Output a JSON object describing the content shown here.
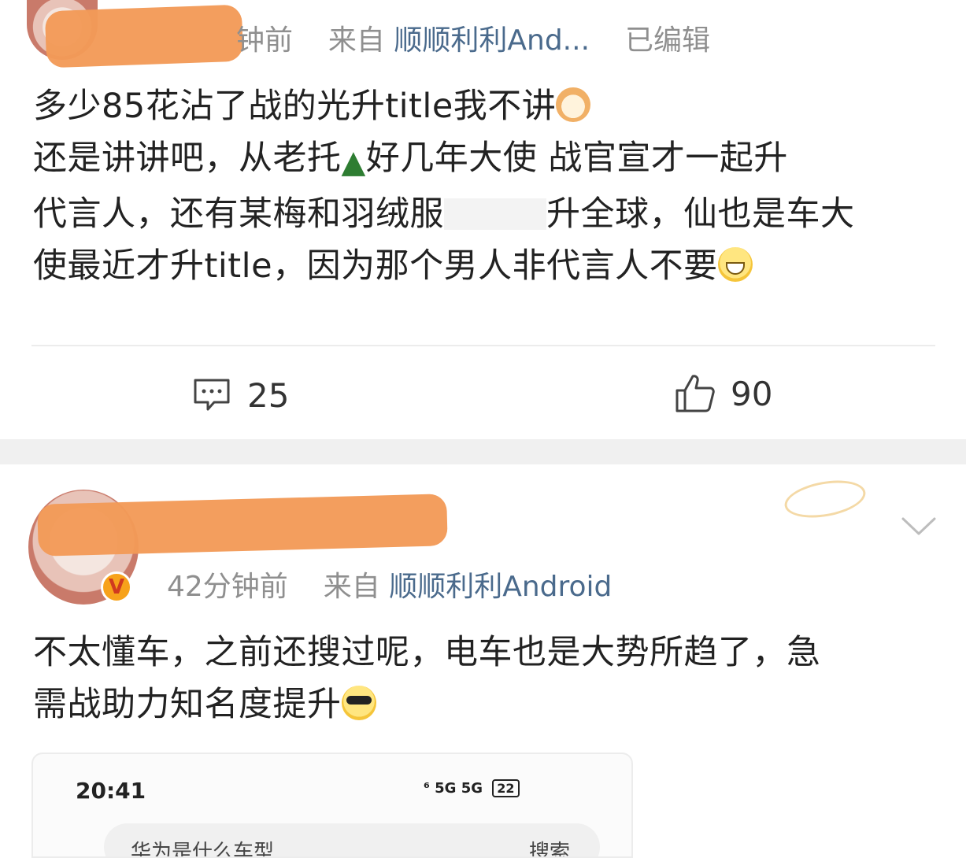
{
  "post1": {
    "time_suffix": "钟前",
    "source_prefix": "来自",
    "source": "顺顺利利And...",
    "edited": "已编辑",
    "lines": [
      "多少85花沾了战的光升title我不讲",
      "还是讲讲吧，从老托",
      "好几年大使 战官宣才一起升",
      "代言人，还有某梅和羽绒服",
      "升全球，仙也是车大",
      "使最近才升title，因为那个男人非代言人不要"
    ],
    "comment_count": "25",
    "like_count": "90"
  },
  "post2": {
    "time": "42分钟前",
    "source_prefix": "来自",
    "source": "顺顺利利Android",
    "verified_badge": "V",
    "lines": [
      "不太懂车，之前还搜过呢，电车也是大势所趋了，急",
      "需战助力知名度提升"
    ]
  },
  "embedded_screenshot": {
    "time": "20:41",
    "status_icons": "⁶ 5G 5G",
    "battery": "22",
    "search_text": "华为是什么车型",
    "search_button": "搜索"
  },
  "icons": {
    "comment": "comment-icon",
    "like": "thumbs-up-icon",
    "chevron": "chevron-down-icon",
    "tree": "evergreen-tree-emoji",
    "cat": "cat-face-emoji",
    "grin": "grinning-emoji",
    "cool": "sunglasses-emoji"
  },
  "colors": {
    "meta_gray": "#8f8f8f",
    "source_blue": "#4a6a8c",
    "redaction_orange": "#f39a57",
    "section_band": "#f0f0f0"
  }
}
